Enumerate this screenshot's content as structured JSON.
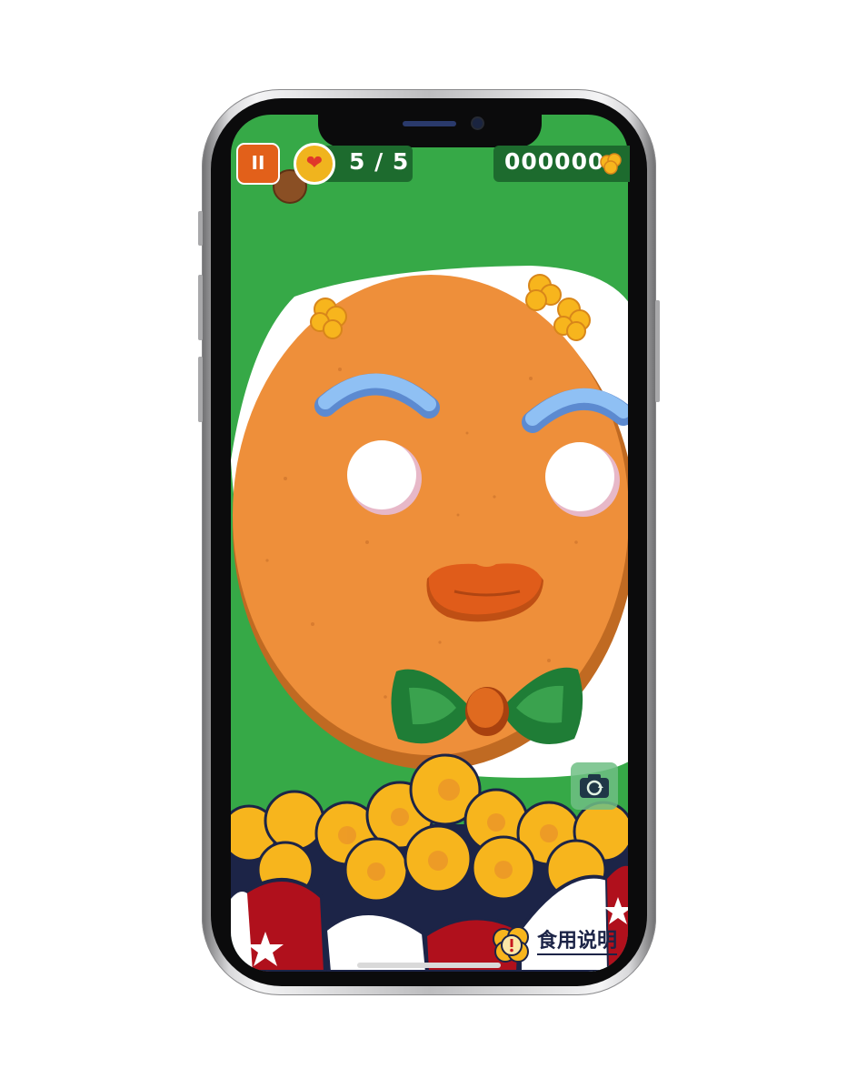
{
  "hud": {
    "pause_label": "II",
    "lives": "5 / 5",
    "score": "000000"
  },
  "footer": {
    "manual_label": "食用说明"
  },
  "icons": {
    "pause": "pause-icon",
    "lives": "heart-icon",
    "score": "popcorn-icon",
    "camera": "camera-rotate-icon",
    "manual": "exclamation-icon"
  },
  "colors": {
    "background": "#36a947",
    "cookie": "#ee8f3a",
    "accent": "#e2601a",
    "hud_panel": "#1d6b2e",
    "popcorn": "#f7b51d",
    "bucket_red": "#b0101c",
    "bucket_navy": "#1c2447",
    "frosting_blue": "#7fb3ec",
    "bow_green": "#1f7d36"
  }
}
